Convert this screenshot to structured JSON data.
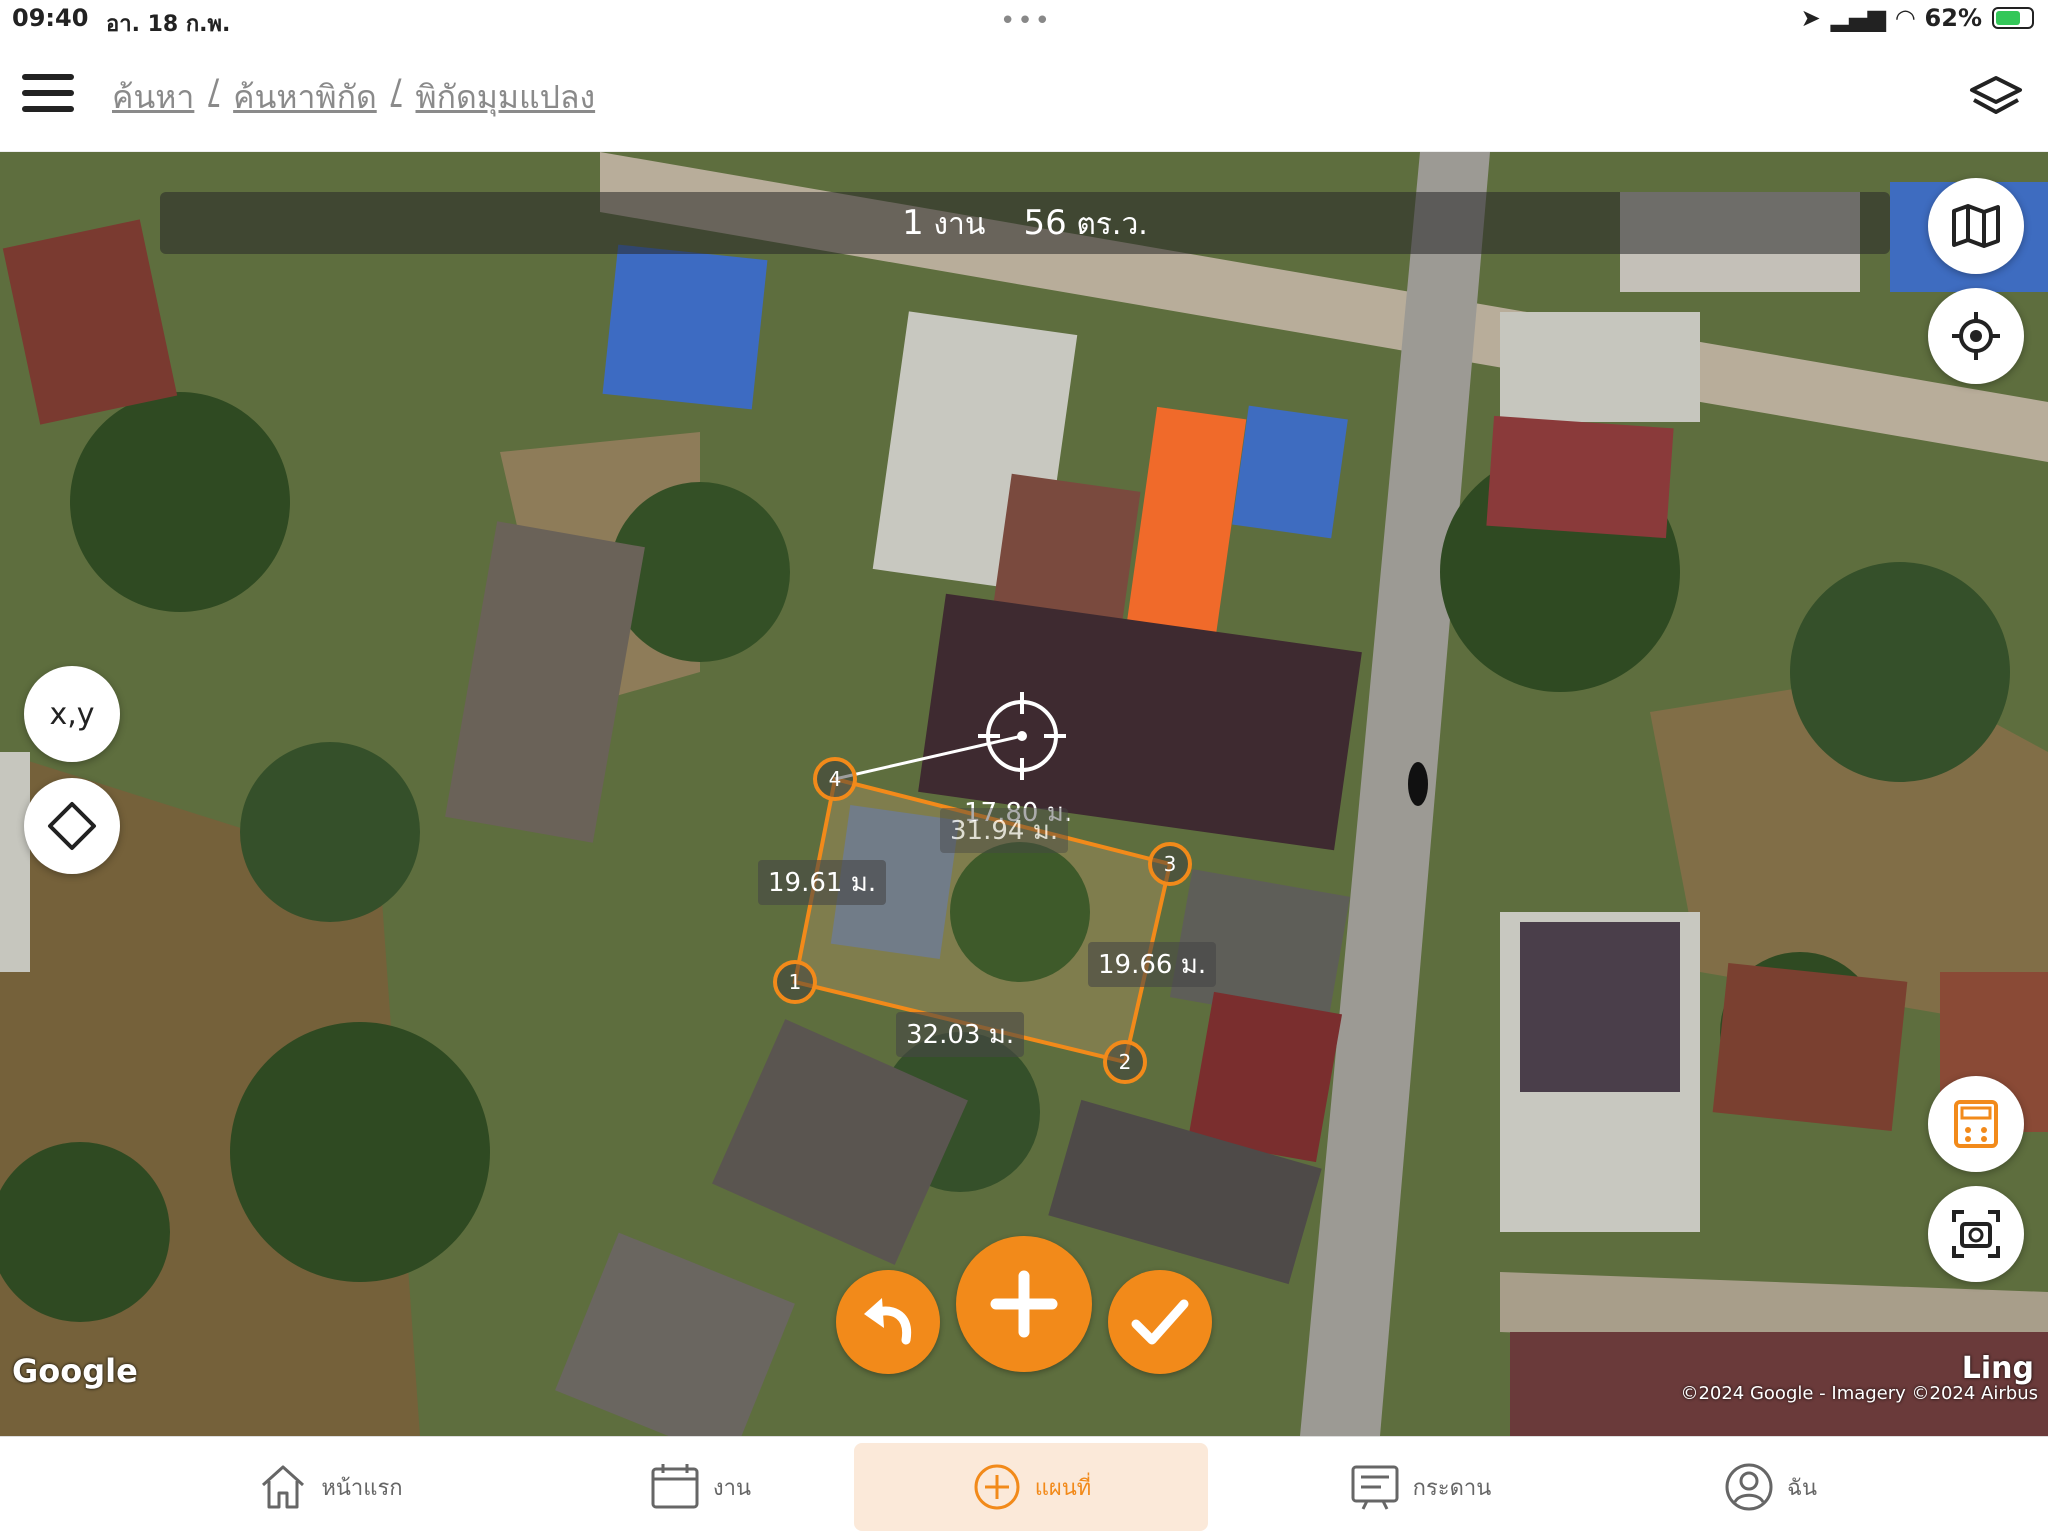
{
  "status_bar": {
    "time": "09:40",
    "date": "อา. 18 ก.พ.",
    "battery": "62%"
  },
  "header": {
    "breadcrumb": [
      "ค้นหา",
      "ค้นหาพิกัด",
      "พิกัดมุมแปลง"
    ]
  },
  "map": {
    "area_unit_value": "1",
    "area_unit_label": "งาน",
    "area_sqwa_value": "56",
    "area_sqwa_label": "ตร.ว.",
    "xy_button_label": "x,y",
    "google_logo": "Google",
    "attribution": "©2024 Google - Imagery ©2024 Airbus",
    "watermark": "Ling",
    "segments": {
      "cursor_distance": "17.80 ม.",
      "side_4_3": "31.94 ม.",
      "side_1_4": "19.61 ม.",
      "side_3_2": "19.66 ม.",
      "side_1_2": "32.03 ม."
    },
    "vertices": [
      "1",
      "2",
      "3",
      "4"
    ]
  },
  "bottom_nav": {
    "items": [
      {
        "label": "หน้าแรก",
        "icon": "home-icon"
      },
      {
        "label": "งาน",
        "icon": "calendar-icon"
      },
      {
        "label": "แผนที่",
        "icon": "plus-circle-icon"
      },
      {
        "label": "กระดาน",
        "icon": "board-icon"
      },
      {
        "label": "ฉัน",
        "icon": "user-icon"
      }
    ],
    "active_index": 2
  },
  "colors": {
    "accent": "#f28a1a",
    "active_bg": "#fbe9d9"
  }
}
